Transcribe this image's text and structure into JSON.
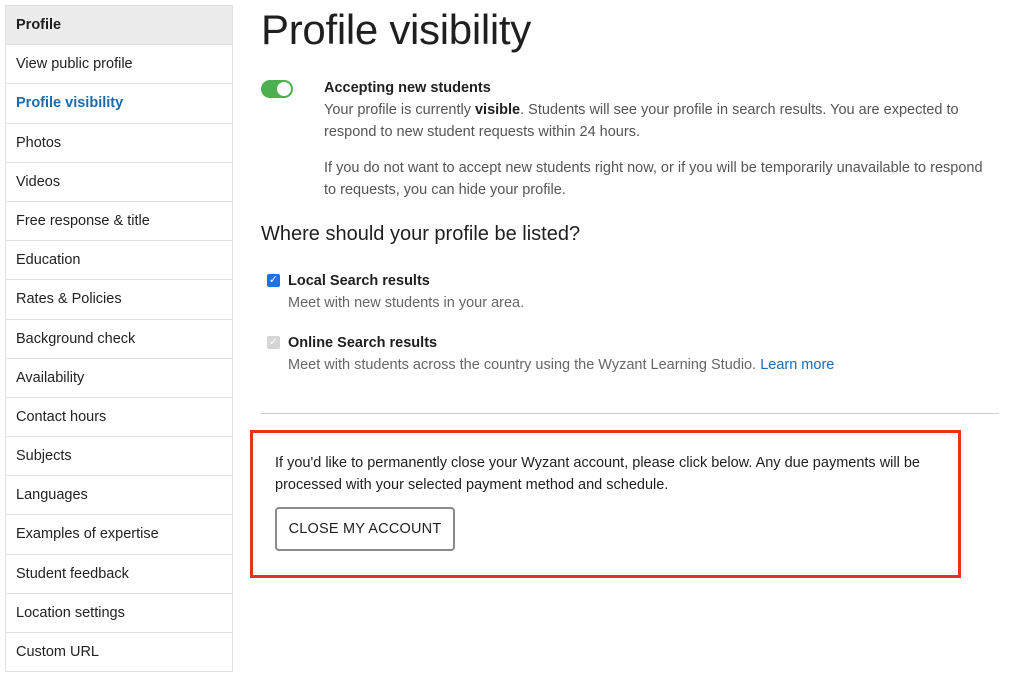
{
  "sidebar": {
    "items": [
      {
        "label": "Profile"
      },
      {
        "label": "View public profile"
      },
      {
        "label": "Profile visibility"
      },
      {
        "label": "Photos"
      },
      {
        "label": "Videos"
      },
      {
        "label": "Free response & title"
      },
      {
        "label": "Education"
      },
      {
        "label": "Rates & Policies"
      },
      {
        "label": "Background check"
      },
      {
        "label": "Availability"
      },
      {
        "label": "Contact hours"
      },
      {
        "label": "Subjects"
      },
      {
        "label": "Languages"
      },
      {
        "label": "Examples of expertise"
      },
      {
        "label": "Student feedback"
      },
      {
        "label": "Location settings"
      },
      {
        "label": "Custom URL"
      }
    ]
  },
  "main": {
    "title": "Profile visibility",
    "accepting": {
      "toggle_state": "on",
      "title": "Accepting new students",
      "text_before": "Your profile is currently ",
      "text_bold": "visible",
      "text_after": ". Students will see your profile in search results. You are expected to respond to new student requests within 24 hours.",
      "text2": "If you do not want to accept new students right now, or if you will be temporarily unavailable to respond to requests, you can hide your profile."
    },
    "listed_heading": "Where should your profile be listed?",
    "local": {
      "checked": true,
      "label": "Local Search results",
      "desc": "Meet with new students in your area."
    },
    "online": {
      "checked": true,
      "disabled": true,
      "label": "Online Search results",
      "desc": "Meet with students across the country using the Wyzant Learning Studio. ",
      "link": "Learn more"
    },
    "close_account": {
      "text": "If you'd like to permanently close your Wyzant account, please click below. Any due payments will be processed with your selected payment method and schedule.",
      "button": "CLOSE MY ACCOUNT"
    }
  },
  "colors": {
    "accent_link": "#1a6bb0",
    "toggle_on": "#4caf50",
    "highlight_border": "#e8321c"
  }
}
